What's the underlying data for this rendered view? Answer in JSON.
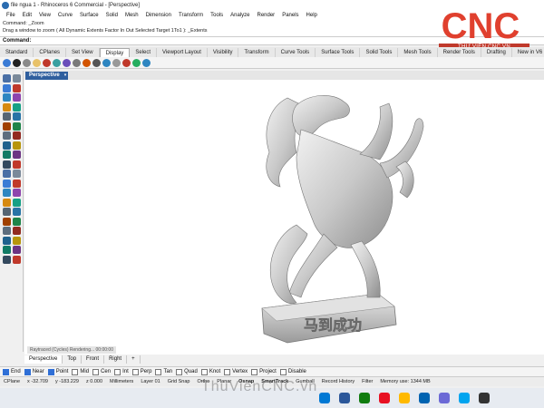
{
  "window": {
    "title": "file ngua 1 - Rhinoceros 6 Commercial - [Perspective]"
  },
  "menu": [
    "File",
    "Edit",
    "View",
    "Curve",
    "Surface",
    "Solid",
    "Mesh",
    "Dimension",
    "Transform",
    "Tools",
    "Analyze",
    "Render",
    "Panels",
    "Help"
  ],
  "command_history": [
    "Command: _Zoom",
    "Drag a window to zoom ( All  Dynamic  Extents  Factor  In  Out  Selected  Target  1To1 ): _Extents"
  ],
  "command_prompt": {
    "label": "Command:",
    "value": ""
  },
  "logo": {
    "text": "CNC",
    "caption": "THƯ VIỆN CNC.VN"
  },
  "toolbar_tabs": [
    "Standard",
    "CPlanes",
    "Set View",
    "Display",
    "Select",
    "Viewport Layout",
    "Visibility",
    "Transform",
    "Curve Tools",
    "Surface Tools",
    "Solid Tools",
    "Mesh Tools",
    "Render Tools",
    "Drafting",
    "New in V6"
  ],
  "active_toolbar_tab": "Display",
  "display_icons": [
    "#3a7bd5",
    "#222222",
    "#8a8a8a",
    "#e8c26a",
    "#c0392b",
    "#3aa0a0",
    "#6b4fbb",
    "#7a7a7a",
    "#d35400",
    "#555555",
    "#2e86c1",
    "#999999",
    "#c0392b",
    "#27ae60",
    "#2e86c1"
  ],
  "viewport": {
    "name": "Perspective",
    "dropdown_icon": "▾",
    "model_inscription": "马到成功",
    "render_status": "Raytraced (Cycles)   Rendering...   00:00:00"
  },
  "viewport_tabs": [
    "Perspective",
    "Top",
    "Front",
    "Right"
  ],
  "add_viewport_icon": "+",
  "osnaps": [
    {
      "label": "End",
      "on": true
    },
    {
      "label": "Near",
      "on": true
    },
    {
      "label": "Point",
      "on": true
    },
    {
      "label": "Mid",
      "on": false
    },
    {
      "label": "Cen",
      "on": false
    },
    {
      "label": "Int",
      "on": false
    },
    {
      "label": "Perp",
      "on": false
    },
    {
      "label": "Tan",
      "on": false
    },
    {
      "label": "Quad",
      "on": false
    },
    {
      "label": "Knot",
      "on": false
    },
    {
      "label": "Vertex",
      "on": false
    },
    {
      "label": "Project",
      "on": false
    },
    {
      "label": "Disable",
      "on": false
    }
  ],
  "status": {
    "cplane": "CPlane",
    "x": "x -32.709",
    "y": "y -183.229",
    "z": "z 0.000",
    "units": "Millimeters",
    "layer": "Layer 01",
    "grid_snap": "Grid Snap",
    "ortho": "Ortho",
    "planar": "Planar",
    "osnap": "Osnap",
    "smarttrack": "SmartTrack",
    "gumball": "Gumball",
    "record_history": "Record History",
    "filter": "Filter",
    "memory": "Memory use: 1344 MB"
  },
  "taskbar_icons": [
    "#0078d4",
    "#2b579a",
    "#107c10",
    "#e81123",
    "#ffb900",
    "#0063b1",
    "#6b69d6",
    "#00a4ef",
    "#333333"
  ],
  "watermark": "ThuVienCNC.vn"
}
